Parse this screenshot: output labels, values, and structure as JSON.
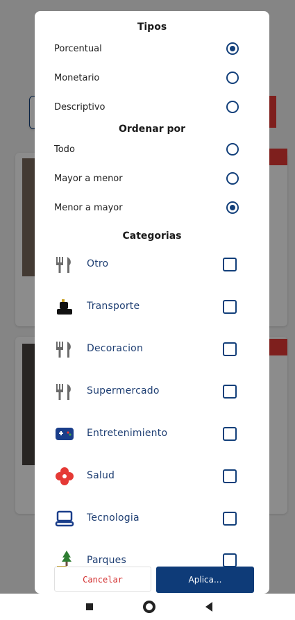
{
  "modal": {
    "types_title": "Tipos",
    "types": [
      {
        "label": "Porcentual",
        "checked": true
      },
      {
        "label": "Monetario",
        "checked": false
      },
      {
        "label": "Descriptivo",
        "checked": false
      }
    ],
    "order_title": "Ordenar por",
    "order": [
      {
        "label": "Todo",
        "checked": false
      },
      {
        "label": "Mayor a menor",
        "checked": false
      },
      {
        "label": "Menor a mayor",
        "checked": true
      }
    ],
    "categories_title": "Categorias",
    "categories": [
      {
        "label": "Otro",
        "icon": "cutlery-icon",
        "checked": false
      },
      {
        "label": "Transporte",
        "icon": "car-icon",
        "checked": false
      },
      {
        "label": "Decoracion",
        "icon": "cutlery-icon",
        "checked": false
      },
      {
        "label": "Supermercado",
        "icon": "cutlery-icon",
        "checked": false
      },
      {
        "label": "Entretenimiento",
        "icon": "gamepad-icon",
        "checked": false
      },
      {
        "label": "Salud",
        "icon": "health-icon",
        "checked": false
      },
      {
        "label": "Tecnologia",
        "icon": "laptop-icon",
        "checked": false
      },
      {
        "label": "Parques",
        "icon": "tree-icon",
        "checked": false
      }
    ],
    "cancel_label": "Cancelar",
    "apply_label": "Aplica..."
  },
  "colors": {
    "primary": "#0e3b78",
    "accent_red": "#d32f2f",
    "category_text": "#1f3f73"
  }
}
